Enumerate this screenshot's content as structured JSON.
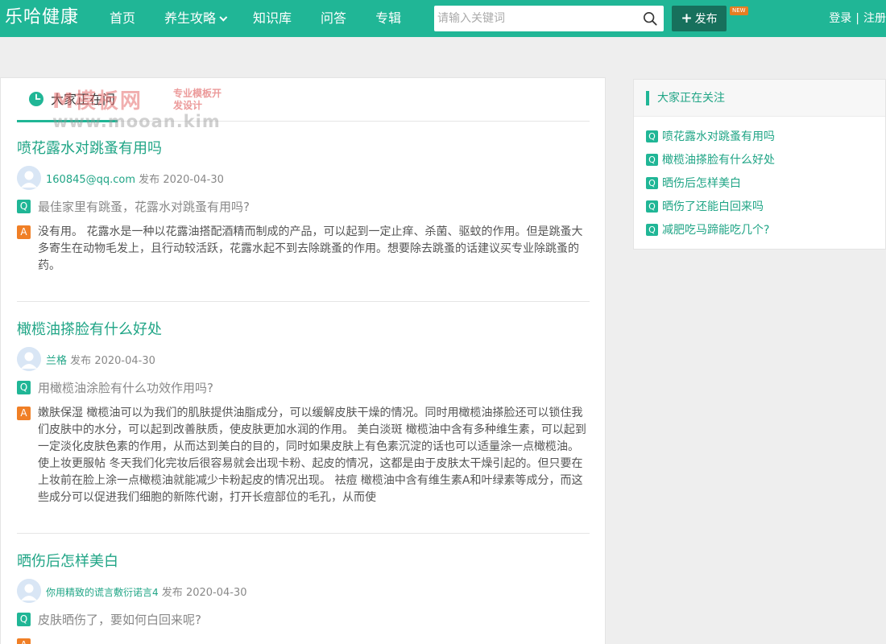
{
  "header": {
    "logo": "乐哈健康",
    "nav": [
      {
        "label": "首页",
        "has_dropdown": false
      },
      {
        "label": "养生攻略",
        "has_dropdown": true
      },
      {
        "label": "知识库",
        "has_dropdown": false
      },
      {
        "label": "问答",
        "has_dropdown": false
      },
      {
        "label": "专辑",
        "has_dropdown": false
      }
    ],
    "search_placeholder": "请输入关键词",
    "publish_label": "发布",
    "new_badge": "NEW",
    "login": "登录",
    "separator": "|",
    "register": "注册"
  },
  "main": {
    "section_title": "大家正在问",
    "watermark": {
      "big": "M模板网",
      "side": "专业模板开发设计",
      "url": "www.mooan.kim"
    },
    "tag_q": "Q",
    "tag_a": "A",
    "questions": [
      {
        "title": "喷花露水对跳蚤有用吗",
        "user": "160845@qq.com",
        "published": "发布",
        "date": "2020-04-30",
        "question": "最佳家里有跳蚤，花露水对跳蚤有用吗?",
        "answer": "没有用。 花露水是一种以花露油搭配酒精而制成的产品，可以起到一定止痒、杀菌、驱蚊的作用。但是跳蚤大多寄生在动物毛发上，且行动较活跃，花露水起不到去除跳蚤的作用。想要除去跳蚤的话建议买专业除跳蚤的药。"
      },
      {
        "title": "橄榄油搽脸有什么好处",
        "user": "兰格",
        "published": "发布",
        "date": "2020-04-30",
        "question": "用橄榄油涂脸有什么功效作用吗?",
        "answer": "嫩肤保湿 橄榄油可以为我们的肌肤提供油脂成分，可以缓解皮肤干燥的情况。同时用橄榄油搽脸还可以锁住我们皮肤中的水分，可以起到改善肤质，使皮肤更加水润的作用。 美白淡斑 橄榄油中含有多种维生素，可以起到一定淡化皮肤色素的作用，从而达到美白的目的，同时如果皮肤上有色素沉淀的话也可以适量涂一点橄榄油。 使上妆更服帖 冬天我们化完妆后很容易就会出现卡粉、起皮的情况，这都是由于皮肤太干燥引起的。但只要在上妆前在脸上涂一点橄榄油就能减少卡粉起皮的情况出现。 祛痘 橄榄油中含有维生素A和叶绿素等成分，而这些成分可以促进我们细胞的新陈代谢，打开长痘部位的毛孔，从而使"
      },
      {
        "title": "晒伤后怎样美白",
        "user": "你用精致的谎言敷衍诺言4",
        "published": "发布",
        "date": "2020-04-30",
        "question": "皮肤晒伤了，要如何白回来呢?",
        "answer": ""
      }
    ]
  },
  "sidebar": {
    "title": "大家正在关注",
    "tag": "Q",
    "items": [
      "喷花露水对跳蚤有用吗",
      "橄榄油搽脸有什么好处",
      "晒伤后怎样美白",
      "晒伤了还能白回来吗",
      "减肥吃马蹄能吃几个?"
    ]
  },
  "colors": {
    "brand": "#20b696",
    "brand_dark": "#17705c",
    "answer_tag": "#f07f26"
  }
}
